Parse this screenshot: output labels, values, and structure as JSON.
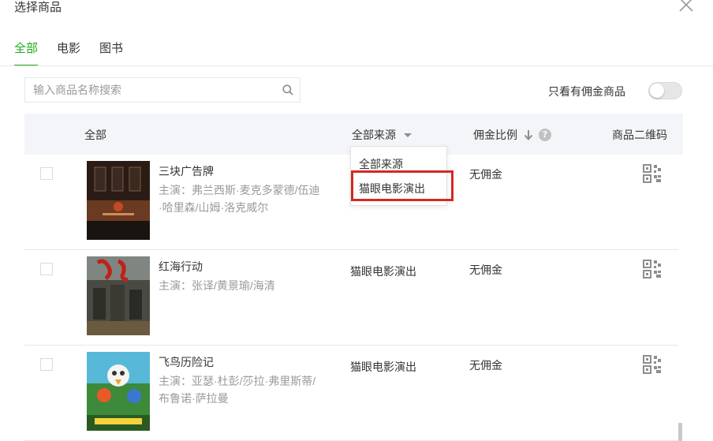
{
  "dialog": {
    "title": "选择商品"
  },
  "tabs": [
    {
      "label": "全部",
      "active": true
    },
    {
      "label": "电影",
      "active": false
    },
    {
      "label": "图书",
      "active": false
    }
  ],
  "search": {
    "placeholder": "输入商品名称搜索",
    "value": ""
  },
  "filter": {
    "label": "只看有佣金商品",
    "enabled": false
  },
  "table": {
    "headers": {
      "all": "全部",
      "source": "全部来源",
      "commission": "佣金比例",
      "qr": "商品二维码"
    },
    "rows": [
      {
        "title": "三块广告牌",
        "cast": "主演：弗兰西斯·麦克多蒙德/伍迪·哈里森/山姆·洛克威尔",
        "source": "",
        "commission": "无佣金"
      },
      {
        "title": "红海行动",
        "cast": "主演：张译/黄景瑜/海清",
        "source": "猫眼电影演出",
        "commission": "无佣金"
      },
      {
        "title": "飞鸟历险记",
        "cast": "主演：亚瑟·杜彭/莎拉·弗里斯蒂/布鲁诺·萨拉曼",
        "source": "猫眼电影演出",
        "commission": "无佣金"
      }
    ]
  },
  "source_dropdown": {
    "options": [
      "全部来源",
      "猫眼电影演出"
    ],
    "highlighted": "猫眼电影演出"
  },
  "colors": {
    "accent": "#1aad19",
    "highlight": "#d22a23",
    "header_bg": "#f4f5f9"
  },
  "icons": {
    "close": "close-icon",
    "search": "search-icon",
    "sort": "arrow-down-icon",
    "help": "question-icon",
    "qr": "qr-code-icon"
  }
}
